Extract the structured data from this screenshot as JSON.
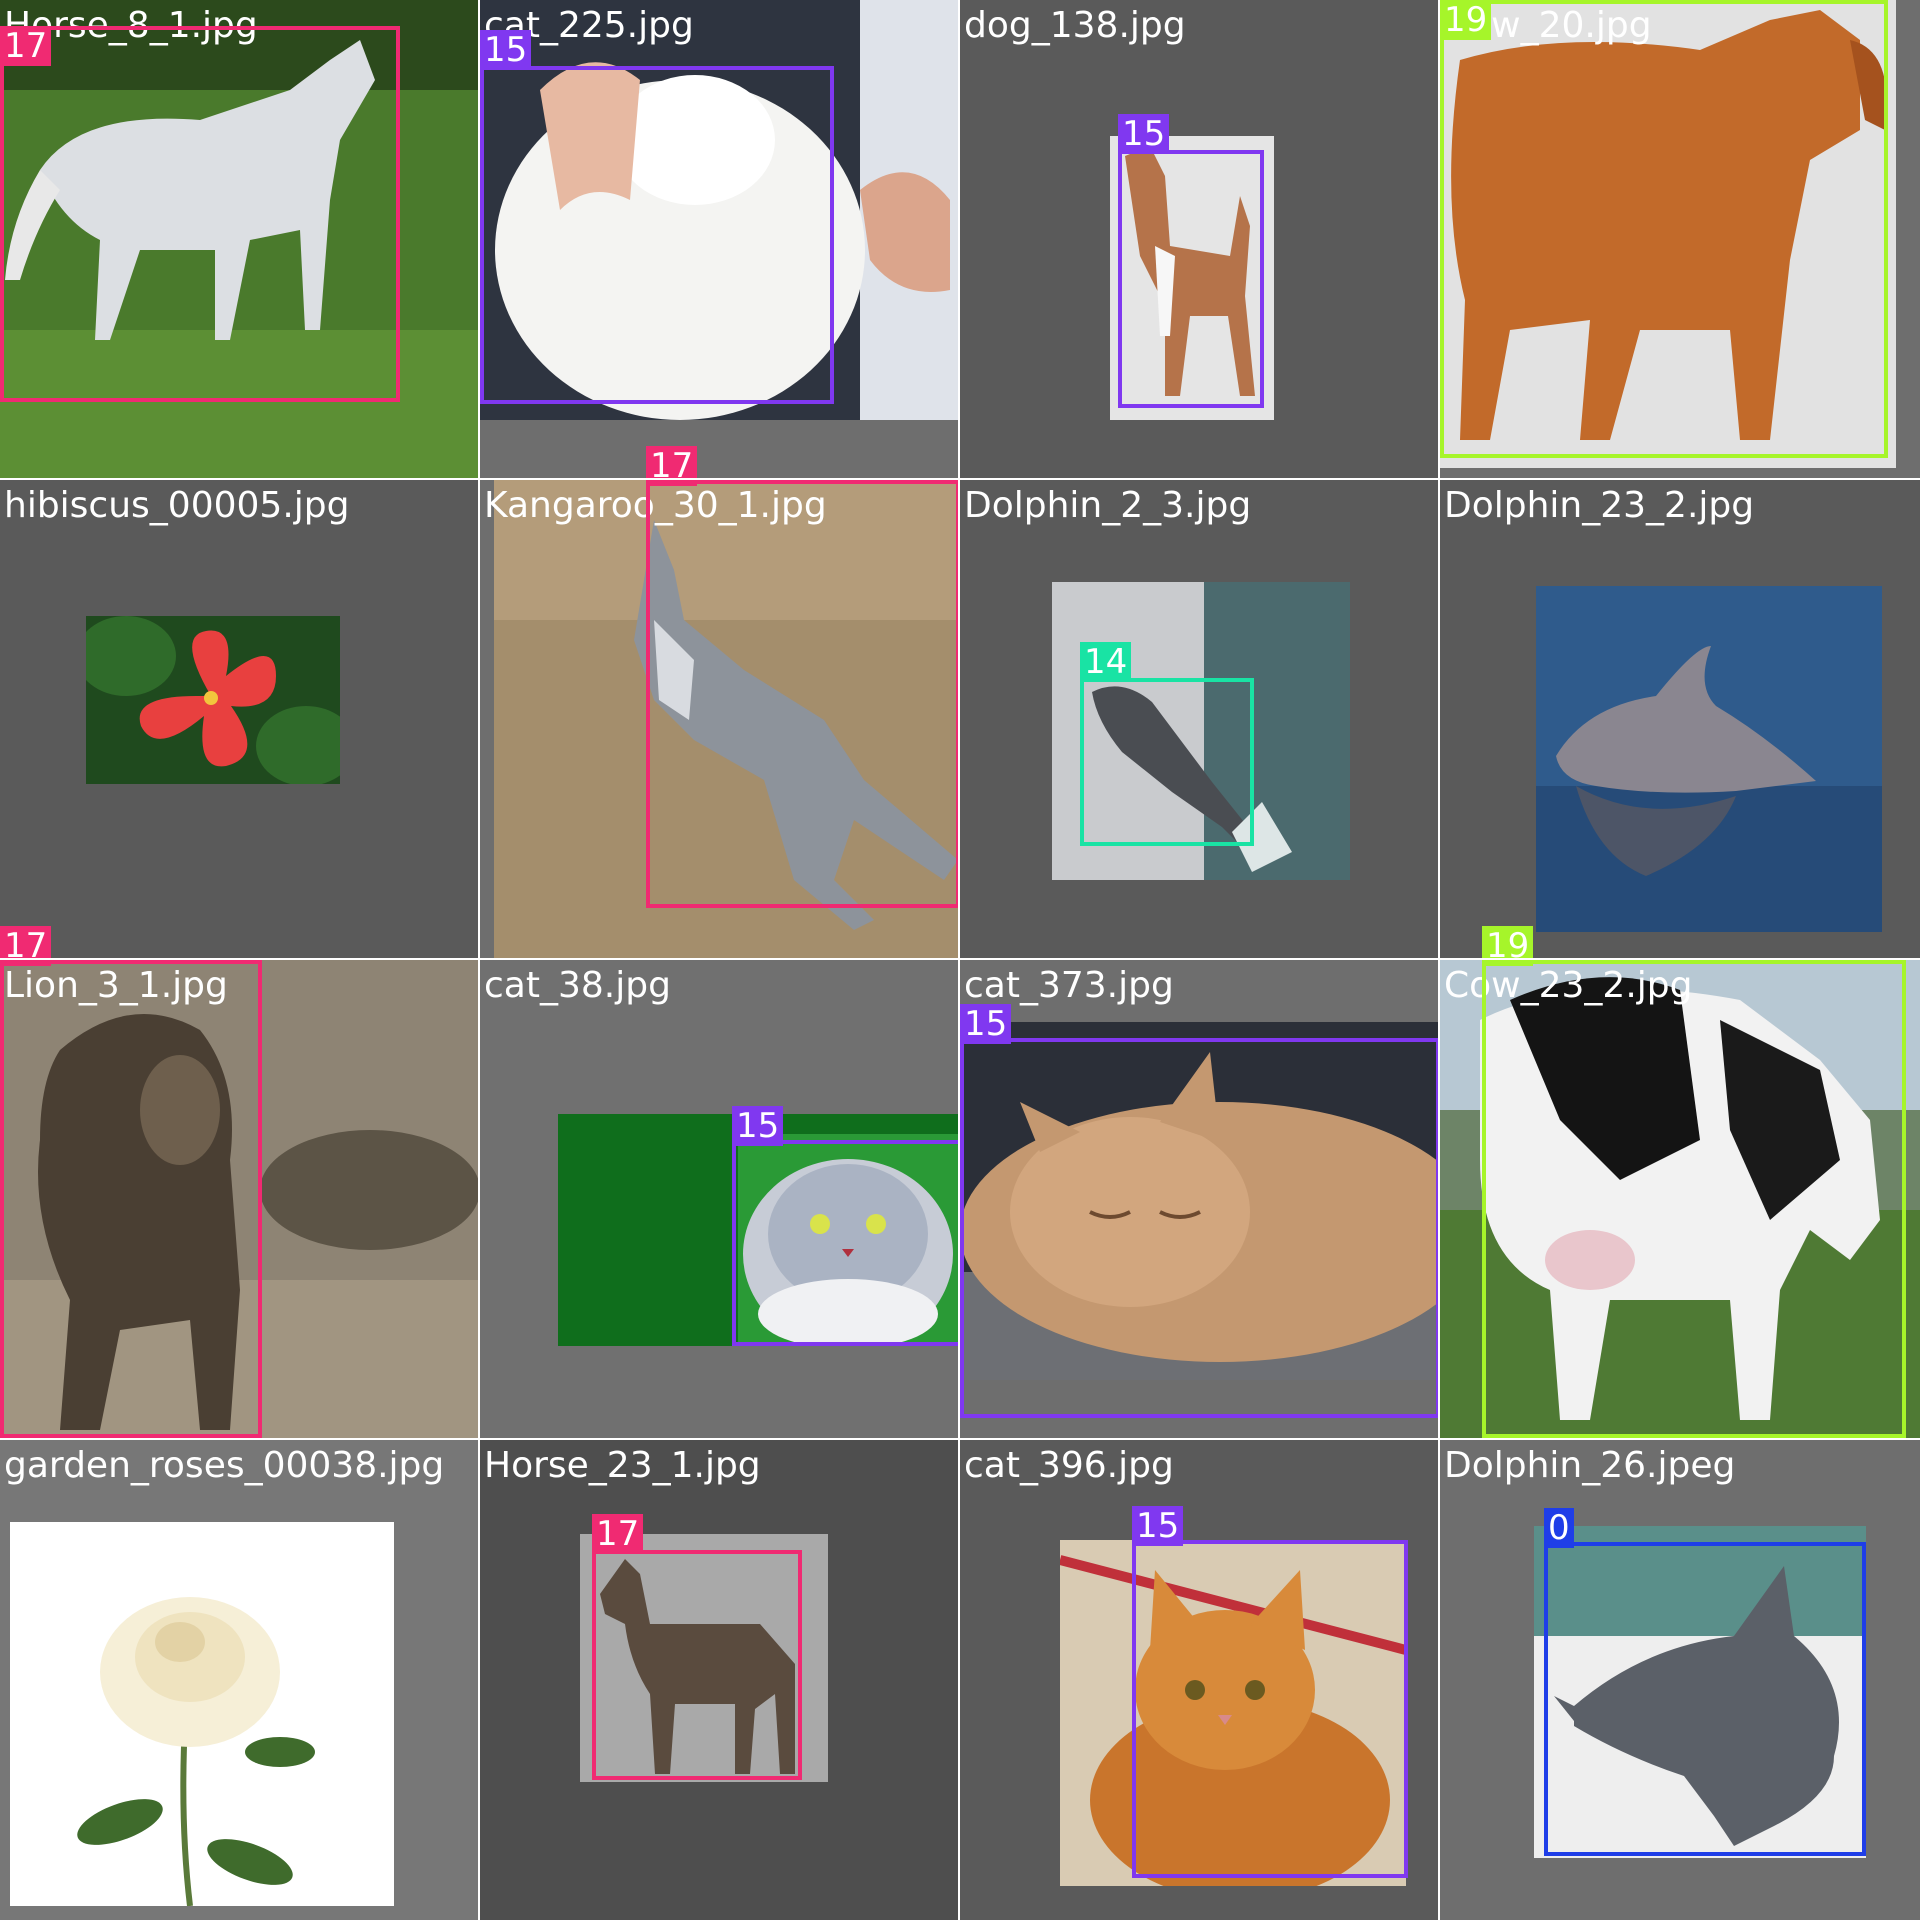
{
  "colors": {
    "class_0": "#1f3ee8",
    "class_14": "#19e3a4",
    "class_15": "#8038f0",
    "class_17": "#f02a72",
    "class_19": "#a6f52a"
  },
  "tiles": [
    {
      "filename": "Horse_8_1.jpg",
      "subject": "horse",
      "labels": [
        "17"
      ]
    },
    {
      "filename": "cat_225.jpg",
      "subject": "cat",
      "labels": [
        "15"
      ]
    },
    {
      "filename": "dog_138.jpg",
      "subject": "dog",
      "labels": [
        "15"
      ]
    },
    {
      "filename": "Cow_20.jpg",
      "subject": "cow",
      "labels": [
        "19"
      ]
    },
    {
      "filename": "hibiscus_00005.jpg",
      "subject": "hibiscus",
      "labels": []
    },
    {
      "filename": "Kangaroo_30_1.jpg",
      "subject": "kangaroo",
      "labels": [
        "17"
      ]
    },
    {
      "filename": "Dolphin_2_3.jpg",
      "subject": "dolphin",
      "labels": [
        "14"
      ]
    },
    {
      "filename": "Dolphin_23_2.jpg",
      "subject": "dolphin",
      "labels": []
    },
    {
      "filename": "Lion_3_1.jpg",
      "subject": "lion",
      "labels": [
        "17"
      ]
    },
    {
      "filename": "cat_38.jpg",
      "subject": "cat",
      "labels": [
        "15"
      ]
    },
    {
      "filename": "cat_373.jpg",
      "subject": "cat",
      "labels": [
        "15"
      ]
    },
    {
      "filename": "Cow_23_2.jpg",
      "subject": "cow",
      "labels": [
        "19"
      ]
    },
    {
      "filename": "garden_roses_00038.jpg",
      "subject": "rose",
      "labels": []
    },
    {
      "filename": "Horse_23_1.jpg",
      "subject": "horse",
      "labels": [
        "17"
      ]
    },
    {
      "filename": "cat_396.jpg",
      "subject": "cat",
      "labels": [
        "15"
      ]
    },
    {
      "filename": "Dolphin_26.jpeg",
      "subject": "dolphin",
      "labels": [
        "0"
      ]
    }
  ]
}
